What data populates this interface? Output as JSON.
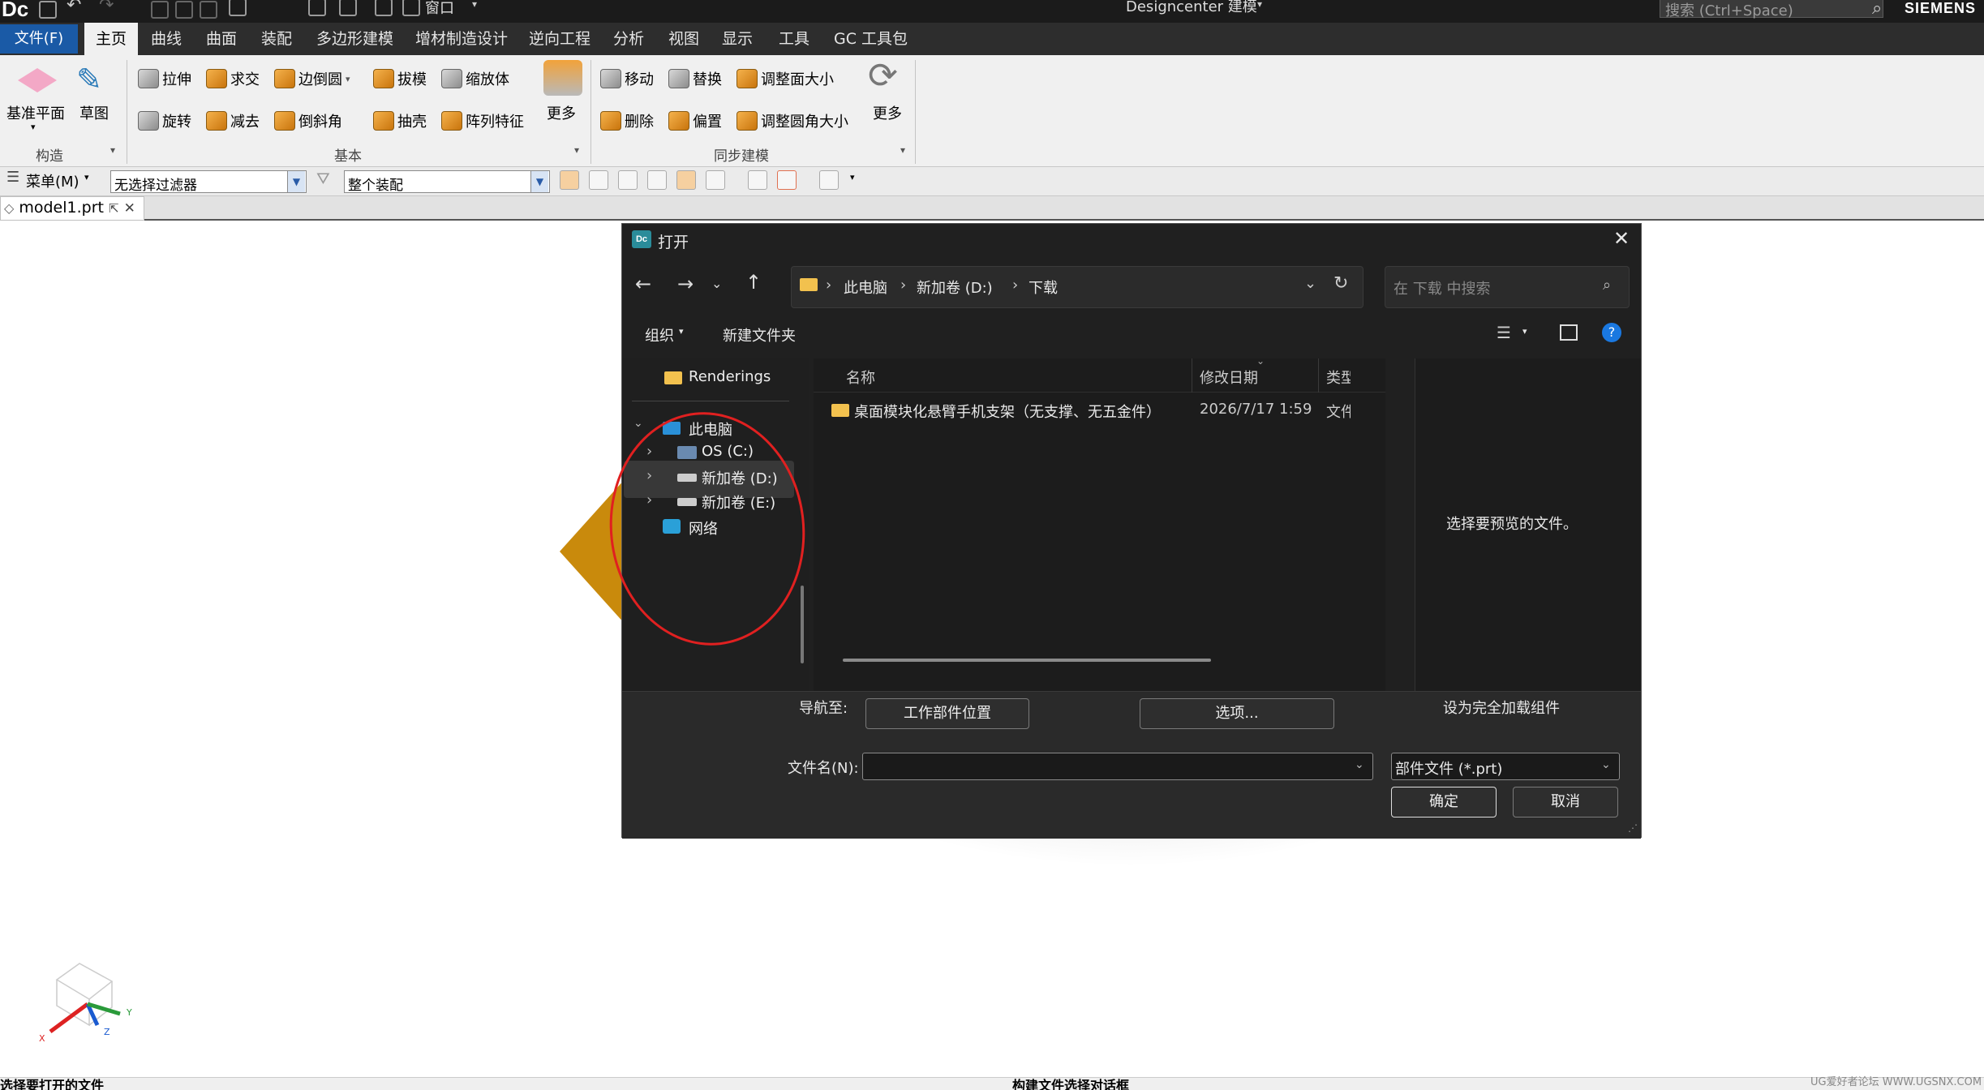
{
  "app": {
    "logo": "Dc",
    "title": "Designcenter  建模",
    "search_placeholder": "搜索 (Ctrl+Space)",
    "brand": "SIEMENS"
  },
  "menu": {
    "file": "文件(F)",
    "tabs": [
      "主页",
      "曲线",
      "曲面",
      "装配",
      "多边形建模",
      "增材制造设计",
      "逆向工程",
      "分析",
      "视图",
      "显示",
      "工具",
      "GC 工具包"
    ],
    "window": "窗口"
  },
  "ribbon": {
    "construct": {
      "datum_plane": "基准平面",
      "sketch": "草图",
      "group": "构造"
    },
    "basic": {
      "extrude": "拉伸",
      "intersect": "求交",
      "edge_blend": "边倒圆",
      "draft": "拔模",
      "scale": "缩放体",
      "revolve": "旋转",
      "subtract": "减去",
      "chamfer": "倒斜角",
      "shell": "抽壳",
      "pattern": "阵列特征",
      "more": "更多",
      "group": "基本"
    },
    "sync": {
      "move": "移动",
      "replace": "替换",
      "resize_face": "调整面大小",
      "delete": "删除",
      "offset": "偏置",
      "resize_blend": "调整圆角大小",
      "more": "更多",
      "group": "同步建模"
    }
  },
  "filterbar": {
    "menu": "菜单(M)",
    "filter": "无选择过滤器",
    "scope": "整个装配"
  },
  "doc_tab": "model1.prt",
  "dialog": {
    "title": "打开",
    "breadcrumb": [
      "此电脑",
      "新加卷 (D:)",
      "下载"
    ],
    "search_placeholder": "在 下载 中搜索",
    "organize": "组织",
    "new_folder": "新建文件夹",
    "nav": {
      "renderings": "Renderings",
      "this_pc": "此电脑",
      "os_c": "OS (C:)",
      "vol_d": "新加卷 (D:)",
      "vol_e": "新加卷 (E:)",
      "network": "网络"
    },
    "columns": {
      "name": "名称",
      "modified": "修改日期",
      "type": "类型"
    },
    "files": [
      {
        "name": "桌面模块化悬臂手机支架（无支撑、无五金件）",
        "modified": "2026/7/17 1:59",
        "type": "文件"
      }
    ],
    "preview": "选择要预览的文件。",
    "navigate_to": "导航至:",
    "work_part_location": "工作部件位置",
    "options": "选项...",
    "fully_load": "设为完全加载组件",
    "filename_label": "文件名(N):",
    "filename_value": "",
    "filetype": "部件文件 (*.prt)",
    "ok": "确定",
    "cancel": "取消"
  },
  "status": {
    "left": "选择要打开的文件",
    "center": "构建文件选择对话框",
    "watermark": "UG爱好者论坛 WWW.UGSNX.COM"
  },
  "axes": {
    "x": "X",
    "y": "Y",
    "z": "Z"
  }
}
